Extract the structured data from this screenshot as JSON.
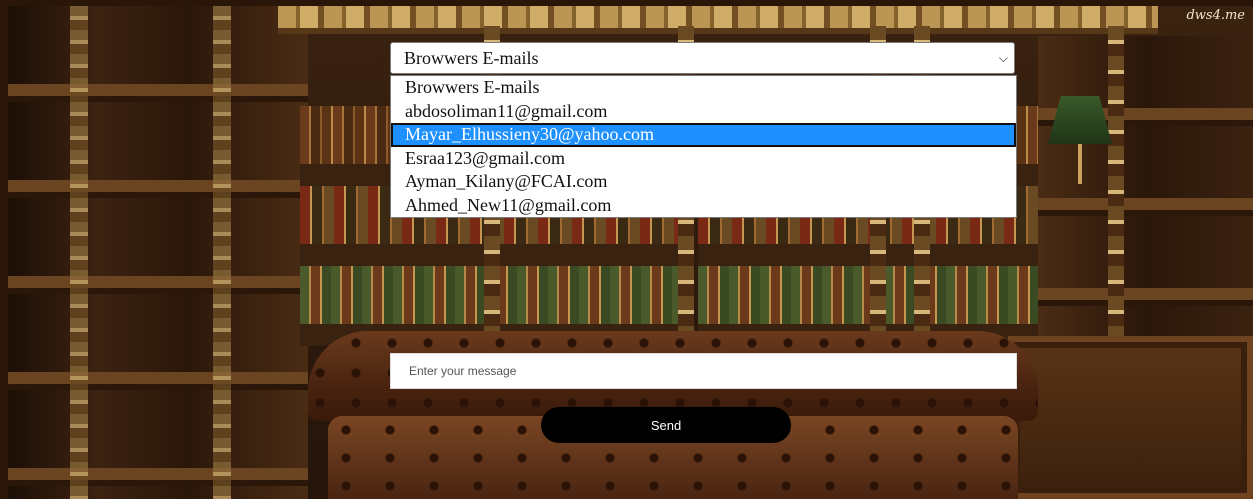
{
  "watermark": "dws4.me",
  "email_select": {
    "selected_value": "Browwers E-mails",
    "arrow_icon": "chevron-down-icon",
    "options": [
      "Browwers E-mails",
      "abdosoliman11@gmail.com",
      "Mayar_Elhussieny30@yahoo.com",
      "Esraa123@gmail.com",
      "Ayman_Kilany@FCAI.com",
      "Ahmed_New11@gmail.com"
    ],
    "highlighted_option": "Mayar_Elhussieny30@yahoo.com"
  },
  "message": {
    "value": "",
    "placeholder": "Enter your message"
  },
  "send_label": "Send",
  "colors": {
    "highlight": "#1e90ff",
    "send_button_bg": "#000000"
  }
}
